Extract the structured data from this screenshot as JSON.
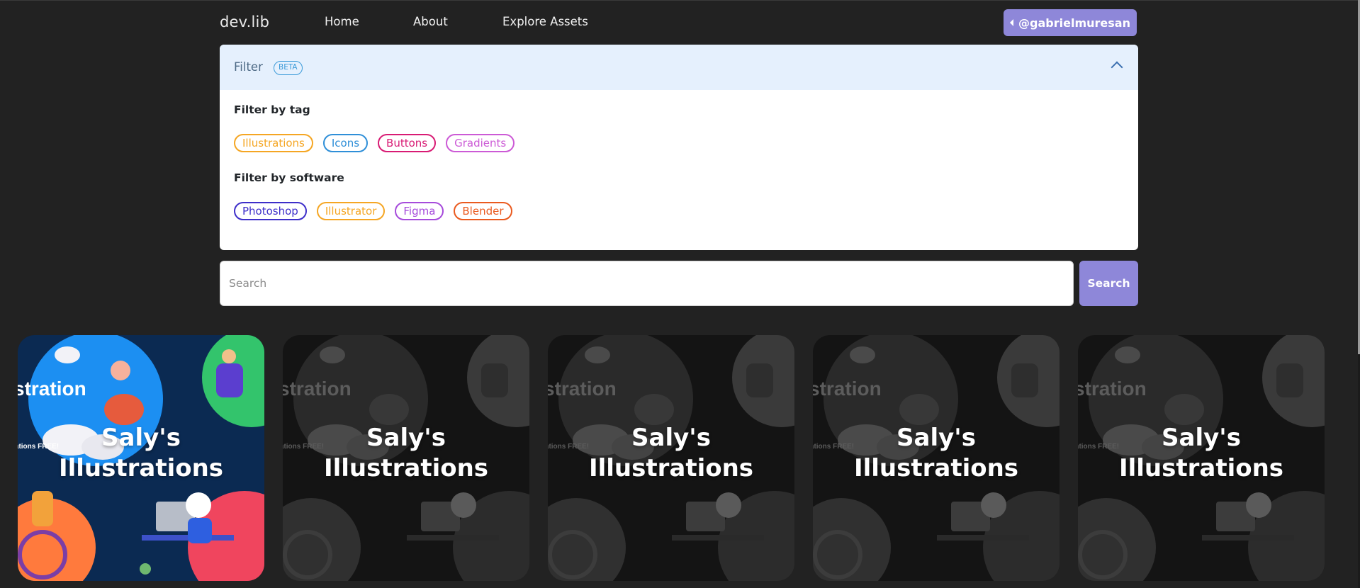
{
  "nav": {
    "brand": "dev.lib",
    "links": [
      "Home",
      "About",
      "Explore Assets"
    ],
    "user": "@gabrielmuresan"
  },
  "filter": {
    "title": "Filter",
    "badge": "BETA",
    "tag_label": "Filter by tag",
    "tags": [
      {
        "label": "Illustrations",
        "color": "#f5a623"
      },
      {
        "label": "Icons",
        "color": "#2f8fd8"
      },
      {
        "label": "Buttons",
        "color": "#d81b74"
      },
      {
        "label": "Gradients",
        "color": "#cc5ad6"
      }
    ],
    "software_label": "Filter by software",
    "software": [
      {
        "label": "Photoshop",
        "color": "#3d2ec9"
      },
      {
        "label": "Illustrator",
        "color": "#f5a623"
      },
      {
        "label": "Figma",
        "color": "#a64bdb"
      },
      {
        "label": "Blender",
        "color": "#ea5a1f"
      }
    ]
  },
  "search": {
    "placeholder": "Search",
    "button": "Search"
  },
  "cards": [
    {
      "title_line1": "Saly's",
      "title_line2": "Illustrations",
      "banner_text": "stration",
      "free_text": "rations FREE!",
      "active": true
    },
    {
      "title_line1": "Saly's",
      "title_line2": "Illustrations",
      "banner_text": "stration",
      "free_text": "rations FREE!",
      "active": false
    },
    {
      "title_line1": "Saly's",
      "title_line2": "Illustrations",
      "banner_text": "stration",
      "free_text": "rations FREE!",
      "active": false
    },
    {
      "title_line1": "Saly's",
      "title_line2": "Illustrations",
      "banner_text": "stration",
      "free_text": "rations FREE!",
      "active": false
    },
    {
      "title_line1": "Saly's",
      "title_line2": "Illustrations",
      "banner_text": "stration",
      "free_text": "rations FREE!",
      "active": false
    }
  ]
}
